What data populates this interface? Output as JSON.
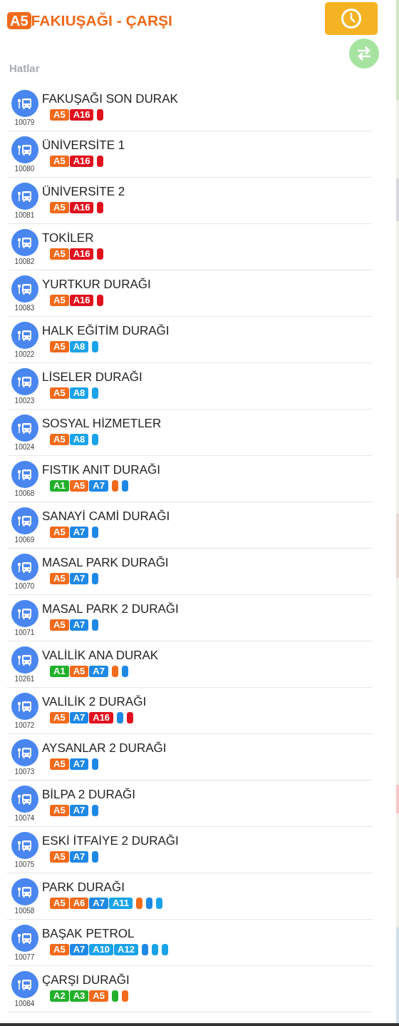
{
  "header": {
    "line_badge": "A5",
    "title": "FAKIUŞAĞI - ÇARŞI"
  },
  "section_title": "Hatlar",
  "stops": [
    {
      "name": "FAKUŞAĞI SON DURAK",
      "code": "10079",
      "lines": [
        {
          "label": "A5",
          "color": "#f26a1b"
        },
        {
          "label": "A16",
          "color": "#e0101e"
        }
      ],
      "dots": [
        {
          "color": "#e0101e"
        }
      ]
    },
    {
      "name": "ÜNİVERSİTE 1",
      "code": "10080",
      "lines": [
        {
          "label": "A5",
          "color": "#f26a1b"
        },
        {
          "label": "A16",
          "color": "#e0101e"
        }
      ],
      "dots": [
        {
          "color": "#e0101e"
        }
      ]
    },
    {
      "name": "ÜNİVERSİTE 2",
      "code": "10081",
      "lines": [
        {
          "label": "A5",
          "color": "#f26a1b"
        },
        {
          "label": "A16",
          "color": "#e0101e"
        }
      ],
      "dots": [
        {
          "color": "#e0101e"
        }
      ]
    },
    {
      "name": "TOKİLER",
      "code": "10082",
      "lines": [
        {
          "label": "A5",
          "color": "#f26a1b"
        },
        {
          "label": "A16",
          "color": "#e0101e"
        }
      ],
      "dots": [
        {
          "color": "#e0101e"
        }
      ]
    },
    {
      "name": "YURTKUR DURAĞI",
      "code": "10083",
      "lines": [
        {
          "label": "A5",
          "color": "#f26a1b"
        },
        {
          "label": "A16",
          "color": "#e0101e"
        }
      ],
      "dots": [
        {
          "color": "#e0101e"
        }
      ]
    },
    {
      "name": "HALK EĞİTİM DURAĞI",
      "code": "10022",
      "lines": [
        {
          "label": "A5",
          "color": "#f26a1b"
        },
        {
          "label": "A8",
          "color": "#1aa3e8"
        }
      ],
      "dots": [
        {
          "color": "#1aa3e8"
        }
      ]
    },
    {
      "name": "LİSELER DURAĞI",
      "code": "10023",
      "lines": [
        {
          "label": "A5",
          "color": "#f26a1b"
        },
        {
          "label": "A8",
          "color": "#1aa3e8"
        }
      ],
      "dots": [
        {
          "color": "#1aa3e8"
        }
      ]
    },
    {
      "name": "SOSYAL HİZMETLER",
      "code": "10024",
      "lines": [
        {
          "label": "A5",
          "color": "#f26a1b"
        },
        {
          "label": "A8",
          "color": "#1aa3e8"
        }
      ],
      "dots": [
        {
          "color": "#1aa3e8"
        }
      ]
    },
    {
      "name": "FISTIK ANIT DURAĞI",
      "code": "10068",
      "lines": [
        {
          "label": "A1",
          "color": "#22b02b"
        },
        {
          "label": "A5",
          "color": "#f26a1b"
        },
        {
          "label": "A7",
          "color": "#1e88e5"
        }
      ],
      "dots": [
        {
          "color": "#f26a1b"
        },
        {
          "color": "#1e88e5"
        }
      ]
    },
    {
      "name": "SANAYİ CAMİ DURAĞI",
      "code": "10069",
      "lines": [
        {
          "label": "A5",
          "color": "#f26a1b"
        },
        {
          "label": "A7",
          "color": "#1e88e5"
        }
      ],
      "dots": [
        {
          "color": "#1e88e5"
        }
      ]
    },
    {
      "name": "MASAL PARK DURAĞI",
      "code": "10070",
      "lines": [
        {
          "label": "A5",
          "color": "#f26a1b"
        },
        {
          "label": "A7",
          "color": "#1e88e5"
        }
      ],
      "dots": [
        {
          "color": "#1e88e5"
        }
      ]
    },
    {
      "name": "MASAL PARK 2 DURAĞI",
      "code": "10071",
      "lines": [
        {
          "label": "A5",
          "color": "#f26a1b"
        },
        {
          "label": "A7",
          "color": "#1e88e5"
        }
      ],
      "dots": [
        {
          "color": "#1e88e5"
        }
      ]
    },
    {
      "name": "VALİLİK ANA DURAK",
      "code": "10261",
      "lines": [
        {
          "label": "A1",
          "color": "#22b02b"
        },
        {
          "label": "A5",
          "color": "#f26a1b"
        },
        {
          "label": "A7",
          "color": "#1e88e5"
        }
      ],
      "dots": [
        {
          "color": "#f26a1b"
        },
        {
          "color": "#1e88e5"
        }
      ]
    },
    {
      "name": "VALİLİK 2 DURAĞI",
      "code": "10072",
      "lines": [
        {
          "label": "A5",
          "color": "#f26a1b"
        },
        {
          "label": "A7",
          "color": "#1e88e5"
        },
        {
          "label": "A16",
          "color": "#e0101e"
        }
      ],
      "dots": [
        {
          "color": "#1e88e5"
        },
        {
          "color": "#e0101e"
        }
      ]
    },
    {
      "name": "AYSANLAR 2 DURAĞI",
      "code": "10073",
      "lines": [
        {
          "label": "A5",
          "color": "#f26a1b"
        },
        {
          "label": "A7",
          "color": "#1e88e5"
        }
      ],
      "dots": [
        {
          "color": "#1e88e5"
        }
      ]
    },
    {
      "name": "BİLPA 2 DURAĞI",
      "code": "10074",
      "lines": [
        {
          "label": "A5",
          "color": "#f26a1b"
        },
        {
          "label": "A7",
          "color": "#1e88e5"
        }
      ],
      "dots": [
        {
          "color": "#1e88e5"
        }
      ]
    },
    {
      "name": "ESKİ İTFAİYE 2 DURAĞI",
      "code": "10075",
      "lines": [
        {
          "label": "A5",
          "color": "#f26a1b"
        },
        {
          "label": "A7",
          "color": "#1e88e5"
        }
      ],
      "dots": [
        {
          "color": "#1e88e5"
        }
      ]
    },
    {
      "name": "PARK DURAĞI",
      "code": "10058",
      "lines": [
        {
          "label": "A5",
          "color": "#f26a1b"
        },
        {
          "label": "A6",
          "color": "#f26a1b"
        },
        {
          "label": "A7",
          "color": "#1e88e5"
        },
        {
          "label": "A11",
          "color": "#1aa3e8"
        }
      ],
      "dots": [
        {
          "color": "#f26a1b"
        },
        {
          "color": "#1e88e5"
        },
        {
          "color": "#1aa3e8"
        }
      ]
    },
    {
      "name": "BAŞAK PETROL",
      "code": "10077",
      "lines": [
        {
          "label": "A5",
          "color": "#f26a1b"
        },
        {
          "label": "A7",
          "color": "#1e88e5"
        },
        {
          "label": "A10",
          "color": "#1aa3e8"
        },
        {
          "label": "A12",
          "color": "#1aa3e8"
        }
      ],
      "dots": [
        {
          "color": "#1e88e5"
        },
        {
          "color": "#1aa3e8"
        },
        {
          "color": "#1aa3e8"
        }
      ]
    },
    {
      "name": "ÇARŞI DURAĞI",
      "code": "10084",
      "lines": [
        {
          "label": "A2",
          "color": "#22b02b"
        },
        {
          "label": "A3",
          "color": "#22b02b"
        },
        {
          "label": "A5",
          "color": "#f26a1b"
        }
      ],
      "dots": [
        {
          "color": "#22b02b"
        },
        {
          "color": "#f26a1b"
        }
      ]
    }
  ]
}
